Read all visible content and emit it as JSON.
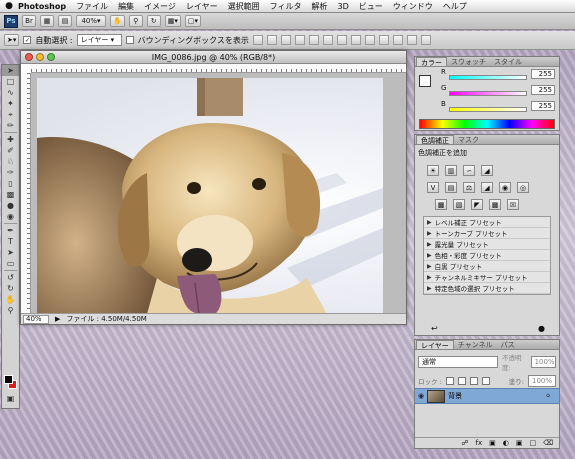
{
  "menubar": {
    "apple": "",
    "app": "Photoshop",
    "items": [
      "ファイル",
      "編集",
      "イメージ",
      "レイヤー",
      "選択範囲",
      "フィルタ",
      "解析",
      "3D",
      "ビュー",
      "ウィンドウ",
      "ヘルプ"
    ]
  },
  "appbar": {
    "logo": "Ps",
    "zoom": "40%"
  },
  "options": {
    "auto_select_label": "自動選択 :",
    "auto_select_value": "レイヤー",
    "bounding_label": "バウンディングボックスを表示"
  },
  "document": {
    "title": "IMG_0086.jpg @ 40% (RGB/8*)",
    "zoom": "40%",
    "status": "ファイル : 4.50M/4.50M"
  },
  "color_panel": {
    "tabs": [
      "カラー",
      "スウォッチ",
      "スタイル"
    ],
    "channels": [
      {
        "label": "R",
        "value": "255"
      },
      {
        "label": "G",
        "value": "255"
      },
      {
        "label": "B",
        "value": "255"
      }
    ],
    "colors": {
      "foreground": "#ffffff",
      "background": "#d91e1e"
    }
  },
  "adjustments_panel": {
    "tabs": [
      "色調補正",
      "マスク"
    ],
    "heading": "色調補正を追加",
    "presets": [
      "レベル補正 プリセット",
      "トーンカーブ プリセット",
      "露光量 プリセット",
      "色相・彩度 プリセット",
      "白黒 プリセット",
      "チャンネルミキサー プリセット",
      "特定色域の選択 プリセット"
    ]
  },
  "layers_panel": {
    "tabs": [
      "レイヤー",
      "チャンネル",
      "パス"
    ],
    "blend_mode": "通常",
    "opacity_label": "不透明度:",
    "opacity_value": "100%",
    "lock_label": "ロック :",
    "fill_label": "塗り:",
    "fill_value": "100%",
    "layer_name": "背景"
  },
  "toolbox": {
    "foreground": "#000000",
    "background": "#d91e1e"
  }
}
